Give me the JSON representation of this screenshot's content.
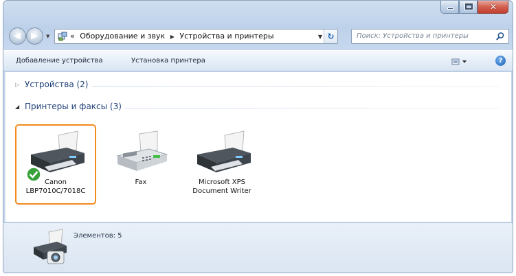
{
  "nav": {
    "breadcrumb_prefix": "«",
    "breadcrumb": [
      "Оборудование и звук",
      "Устройства и принтеры"
    ],
    "search_placeholder": "Поиск: Устройства и принтеры"
  },
  "commands": {
    "add_device": "Добавление устройства",
    "install_printer": "Установка принтера"
  },
  "groups": {
    "devices": "Устройства (2)",
    "printers": "Принтеры и факсы (3)"
  },
  "printers": [
    {
      "label": "Canon\nLBP7010C/7018C",
      "selected": true,
      "default": true
    },
    {
      "label": "Fax",
      "selected": false,
      "default": false
    },
    {
      "label": "Microsoft XPS\nDocument Writer",
      "selected": false,
      "default": false
    }
  ],
  "details": {
    "count_text": "Элементов: 5"
  },
  "colors": {
    "selection_border": "#f28a1e",
    "group_title": "#1e3f78"
  }
}
